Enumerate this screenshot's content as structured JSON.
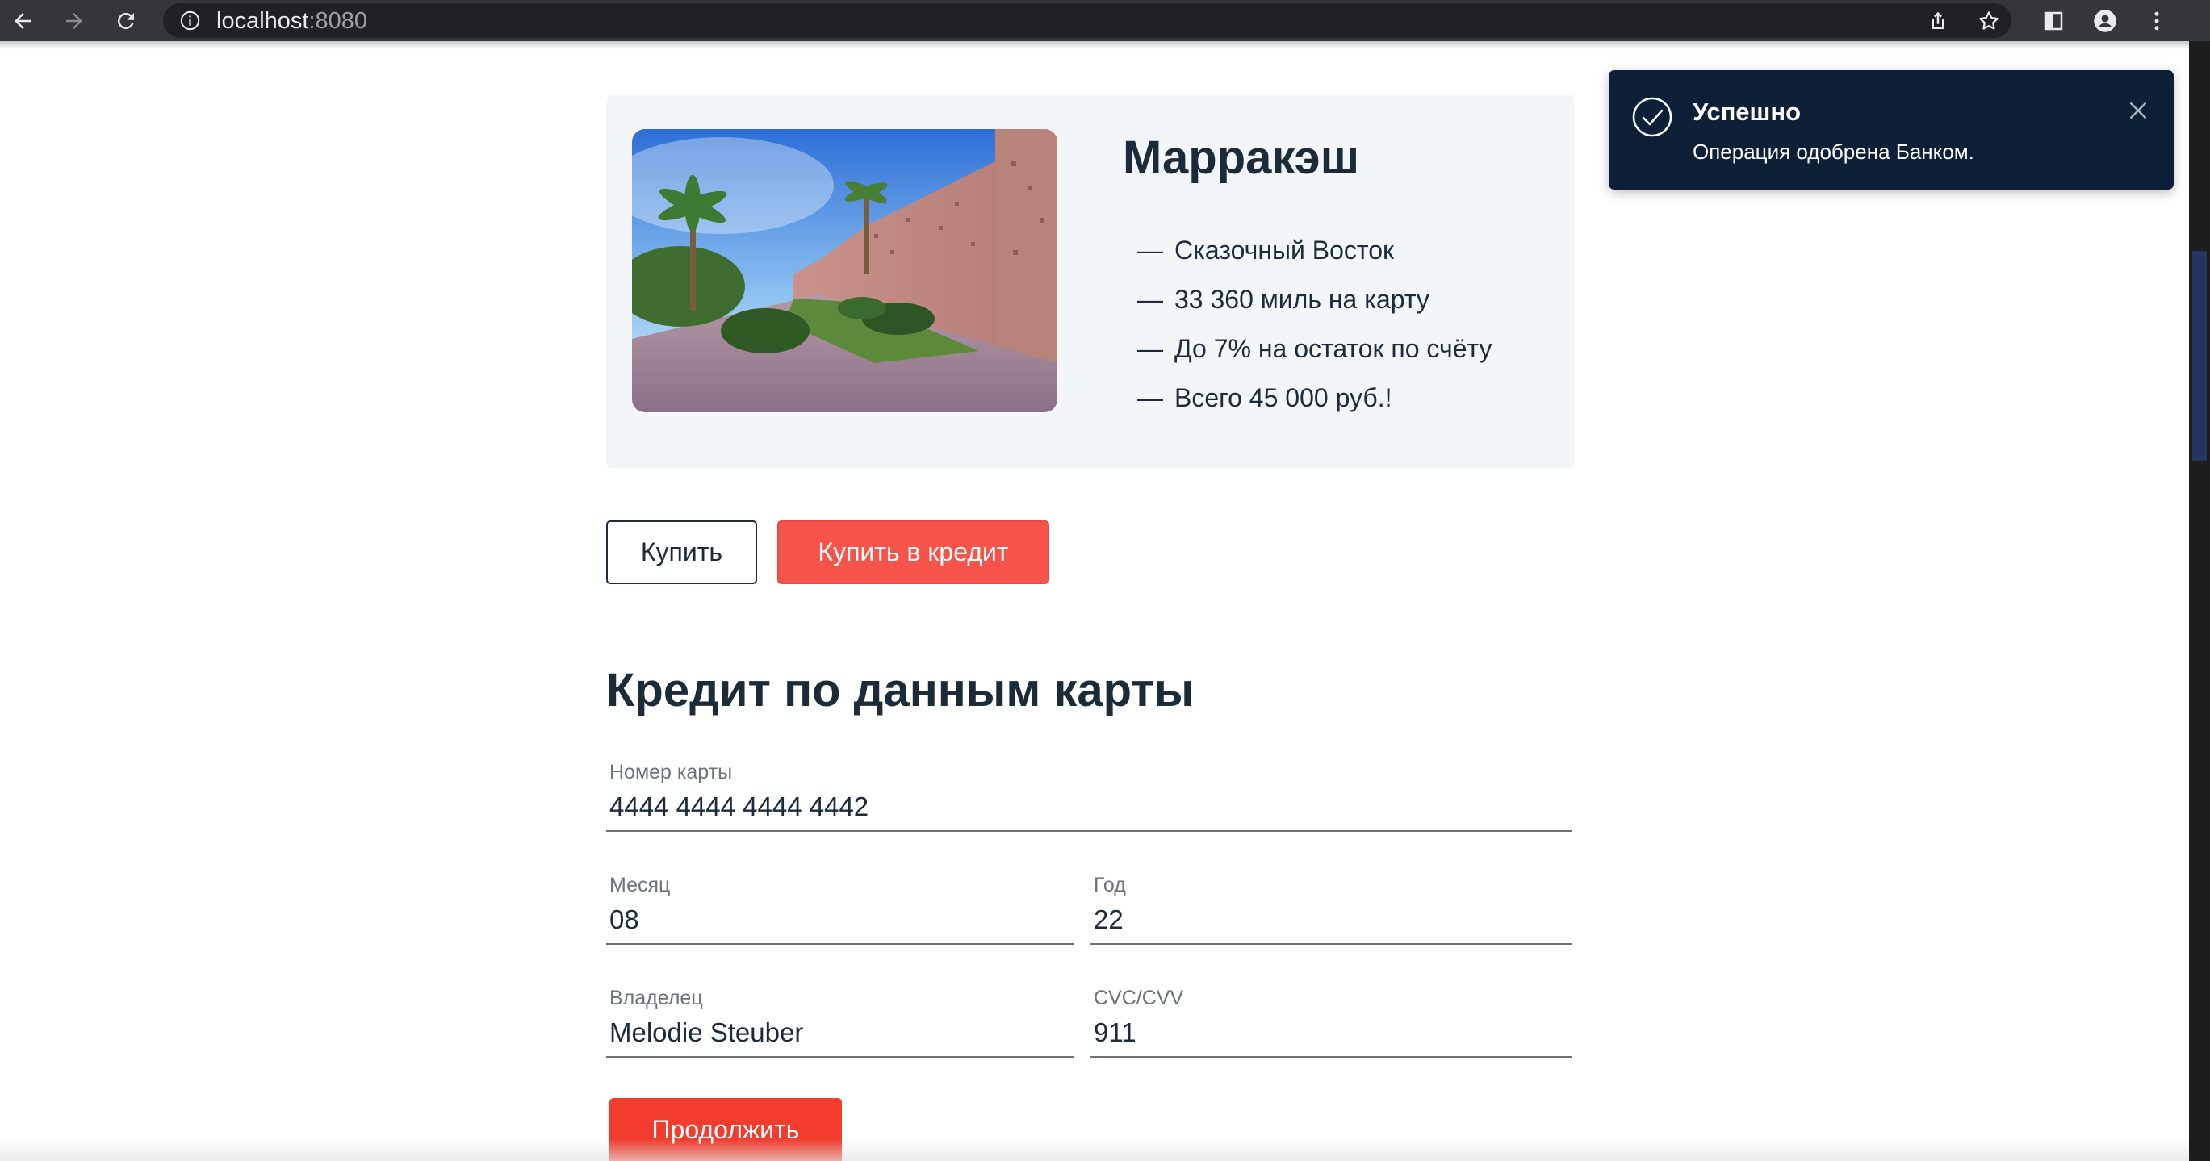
{
  "browser": {
    "url_host": "localhost",
    "url_port": ":8080"
  },
  "tour": {
    "city": "Марракэш",
    "features": [
      {
        "dash": "—",
        "text": "Сказочный Восток"
      },
      {
        "dash": "—",
        "text": "33 360 миль на карту"
      },
      {
        "dash": "—",
        "text": "До 7% на остаток по счёту"
      },
      {
        "dash": "—",
        "text": "Всего 45 000 руб.!"
      }
    ]
  },
  "actions": {
    "buy_label": "Купить",
    "buy_credit_label": "Купить в кредит"
  },
  "form": {
    "title": "Кредит по данным карты",
    "card_number": {
      "label": "Номер карты",
      "value": "4444 4444 4444 4442"
    },
    "month": {
      "label": "Месяц",
      "value": "08"
    },
    "year": {
      "label": "Год",
      "value": "22"
    },
    "owner": {
      "label": "Владелец",
      "value": "Melodie Steuber"
    },
    "cvc": {
      "label": "CVC/CVV",
      "value": "911"
    },
    "continue_label": "Продолжить"
  },
  "notification": {
    "title": "Успешно",
    "message": "Операция одобрена Банком."
  },
  "colors": {
    "accent_red": "#f6544b",
    "continue_red": "#f23c2e",
    "toast_bg": "#0e2038",
    "text_dark": "#1b2b3a",
    "card_bg": "#f3f6f8"
  }
}
